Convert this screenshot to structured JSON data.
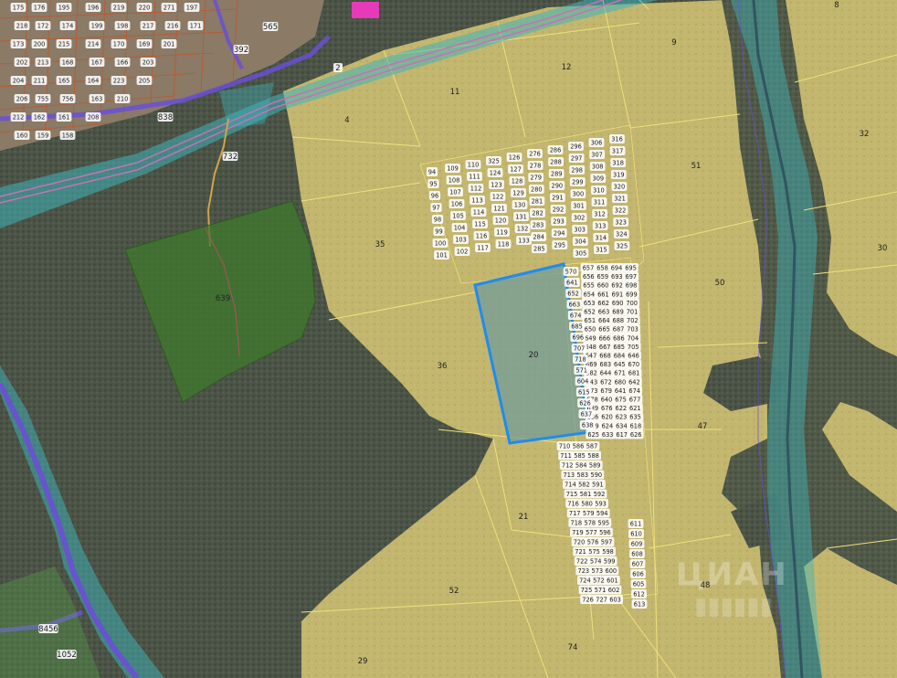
{
  "map": {
    "highlighted_parcel": "20",
    "colors": {
      "yellow_fill": "#d8cc7a",
      "yellow_line": "#efe07a",
      "highlight_border": "#1e8cf0",
      "highlight_fill": "#6e9a9a",
      "green_fill": "#3e7a2c",
      "teal_band": "#3fb5bc",
      "purple_road": "#6a4fd6",
      "forest": "#4a5245"
    },
    "watermark": "ЦИАН"
  },
  "parcels": [
    {
      "id": "p8",
      "label": "8"
    },
    {
      "id": "p9",
      "label": "9"
    },
    {
      "id": "p12",
      "label": "12"
    },
    {
      "id": "p11",
      "label": "11"
    },
    {
      "id": "p4",
      "label": "4"
    },
    {
      "id": "p2",
      "label": "2"
    },
    {
      "id": "p32",
      "label": "32"
    },
    {
      "id": "p51",
      "label": "51"
    },
    {
      "id": "p30",
      "label": "30"
    },
    {
      "id": "p35",
      "label": "35"
    },
    {
      "id": "p50",
      "label": "50"
    },
    {
      "id": "p36",
      "label": "36"
    },
    {
      "id": "p20",
      "label": "20"
    },
    {
      "id": "p47",
      "label": "47"
    },
    {
      "id": "p21",
      "label": "21"
    },
    {
      "id": "p48",
      "label": "48"
    },
    {
      "id": "p52",
      "label": "52"
    },
    {
      "id": "p74",
      "label": "74"
    },
    {
      "id": "p29",
      "label": "29"
    },
    {
      "id": "p639",
      "label": "639"
    },
    {
      "id": "p732",
      "label": "732"
    },
    {
      "id": "p565",
      "label": "565"
    },
    {
      "id": "p392",
      "label": "392"
    },
    {
      "id": "p838",
      "label": "838"
    },
    {
      "id": "p1052",
      "label": "1052"
    },
    {
      "id": "p8456",
      "label": "8456"
    }
  ],
  "village_labels": [
    "175",
    "176",
    "195",
    "196",
    "219",
    "220",
    "271",
    "197",
    "218",
    "172",
    "174",
    "199",
    "198",
    "217",
    "216",
    "171",
    "173",
    "200",
    "215",
    "214",
    "170",
    "169",
    "201",
    "202",
    "213",
    "168",
    "167",
    "166",
    "203",
    "204",
    "211",
    "165",
    "164",
    "223",
    "205",
    "206",
    "755",
    "756",
    "163",
    "210",
    "212",
    "162",
    "161",
    "208",
    "160",
    "159",
    "158"
  ],
  "plot_labels": {
    "grid": [
      [
        "94",
        "109",
        "110",
        "325",
        "126",
        "276",
        "286",
        "296",
        "306",
        "316"
      ],
      [
        "95",
        "108",
        "111",
        "124",
        "127",
        "278",
        "288",
        "297",
        "307",
        "317"
      ],
      [
        "96",
        "107",
        "112",
        "123",
        "128",
        "279",
        "289",
        "298",
        "308",
        "318"
      ],
      [
        "97",
        "106",
        "113",
        "122",
        "129",
        "280",
        "290",
        "299",
        "309",
        "319"
      ],
      [
        "98",
        "105",
        "114",
        "121",
        "130",
        "281",
        "291",
        "300",
        "310",
        "320"
      ],
      [
        "99",
        "104",
        "115",
        "120",
        "131",
        "282",
        "292",
        "301",
        "311",
        "321"
      ],
      [
        "100",
        "103",
        "116",
        "119",
        "132",
        "283",
        "293",
        "302",
        "312",
        "322"
      ],
      [
        "101",
        "102",
        "117",
        "118",
        "133",
        "284",
        "294",
        "303",
        "313",
        "323"
      ],
      [
        "",
        "",
        "",
        "",
        "",
        "285",
        "295",
        "304",
        "314",
        "324"
      ],
      [
        "",
        "",
        "",
        "",
        "",
        "",
        "",
        "305",
        "315",
        "325"
      ]
    ],
    "right_column": [
      "657",
      "658",
      "694",
      "695",
      "656",
      "659",
      "693",
      "697",
      "655",
      "660",
      "692",
      "698",
      "654",
      "661",
      "691",
      "699",
      "653",
      "662",
      "690",
      "700",
      "652",
      "663",
      "689",
      "701",
      "651",
      "664",
      "688",
      "702",
      "650",
      "665",
      "687",
      "703",
      "649",
      "666",
      "686",
      "704",
      "648",
      "667",
      "685",
      "705",
      "647",
      "668",
      "684",
      "646",
      "669",
      "683",
      "645",
      "670",
      "682",
      "644",
      "671",
      "681",
      "643",
      "672",
      "680",
      "642",
      "673",
      "679",
      "641",
      "674",
      "678",
      "640",
      "675",
      "677",
      "639",
      "676",
      "622",
      "621",
      "636",
      "620",
      "623",
      "635",
      "619",
      "624",
      "634",
      "618",
      "625",
      "633",
      "617",
      "626",
      "632",
      "616",
      "627",
      "631",
      "615",
      "628",
      "630",
      "614",
      "629"
    ],
    "left_column": [
      "570",
      "641",
      "652",
      "663",
      "674",
      "685",
      "696",
      "707",
      "718",
      "571",
      "604",
      "615",
      "626",
      "637",
      "638"
    ],
    "bottom_pair": [
      "710",
      "586",
      "587",
      "711",
      "585",
      "588",
      "712",
      "584",
      "589",
      "713",
      "583",
      "590",
      "714",
      "582",
      "591",
      "715",
      "581",
      "592",
      "716",
      "580",
      "593",
      "717",
      "579",
      "594",
      "718",
      "578",
      "595",
      "719",
      "577",
      "596",
      "720",
      "576",
      "597",
      "721",
      "575",
      "598",
      "722",
      "574",
      "599",
      "723",
      "573",
      "600",
      "724",
      "572",
      "601",
      "725",
      "571",
      "602",
      "726",
      "727",
      "603"
    ],
    "bottom_right": [
      "611",
      "610",
      "609",
      "608",
      "607",
      "606",
      "605",
      "612",
      "613"
    ]
  }
}
